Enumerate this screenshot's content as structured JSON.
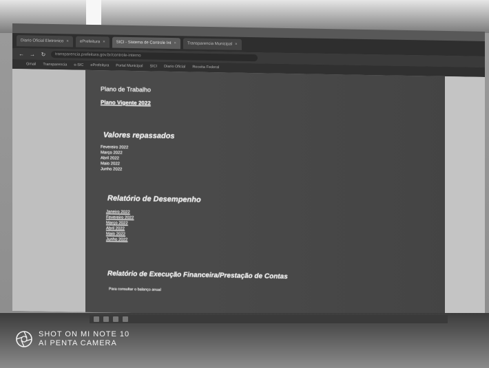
{
  "browser": {
    "tabs": [
      {
        "label": "Diario Oficial Eletronico",
        "active": false
      },
      {
        "label": "ePrefeitura",
        "active": false
      },
      {
        "label": "SICI - Sistema de Controle Int",
        "active": true
      },
      {
        "label": "Transparencia Municipal",
        "active": false
      }
    ],
    "url": "transparencia.prefeitura.gov.br/controle-interno",
    "bookmarks": [
      "Gmail",
      "Transparencia",
      "e-SIC",
      "ePrefeitura",
      "Portal Municipal",
      "SICI",
      "Diario Oficial",
      "Receita Federal"
    ]
  },
  "page": {
    "heading_top": "Plano de Trabalho",
    "plano_link": "Plano Vigente 2022",
    "section1_title": "Valores repassados",
    "section1_items": [
      "Fevereiro 2022",
      "Março 2022",
      "Abril 2022",
      "Maio 2022",
      "Junho 2022"
    ],
    "section2_title": "Relatório de Desempenho",
    "section2_items": [
      "Janeiro 2022",
      "Fevereiro 2022",
      "Março 2022",
      "Abril 2022",
      "Maio 2022",
      "Junho 2022"
    ],
    "section3_title": "Relatório de Execução Financeira/Prestação de Contas",
    "section3_sub": "Para consultar o balanço anual"
  },
  "watermark": {
    "line1": "SHOT ON MI NOTE 10",
    "line2": "AI PENTA CAMERA"
  }
}
